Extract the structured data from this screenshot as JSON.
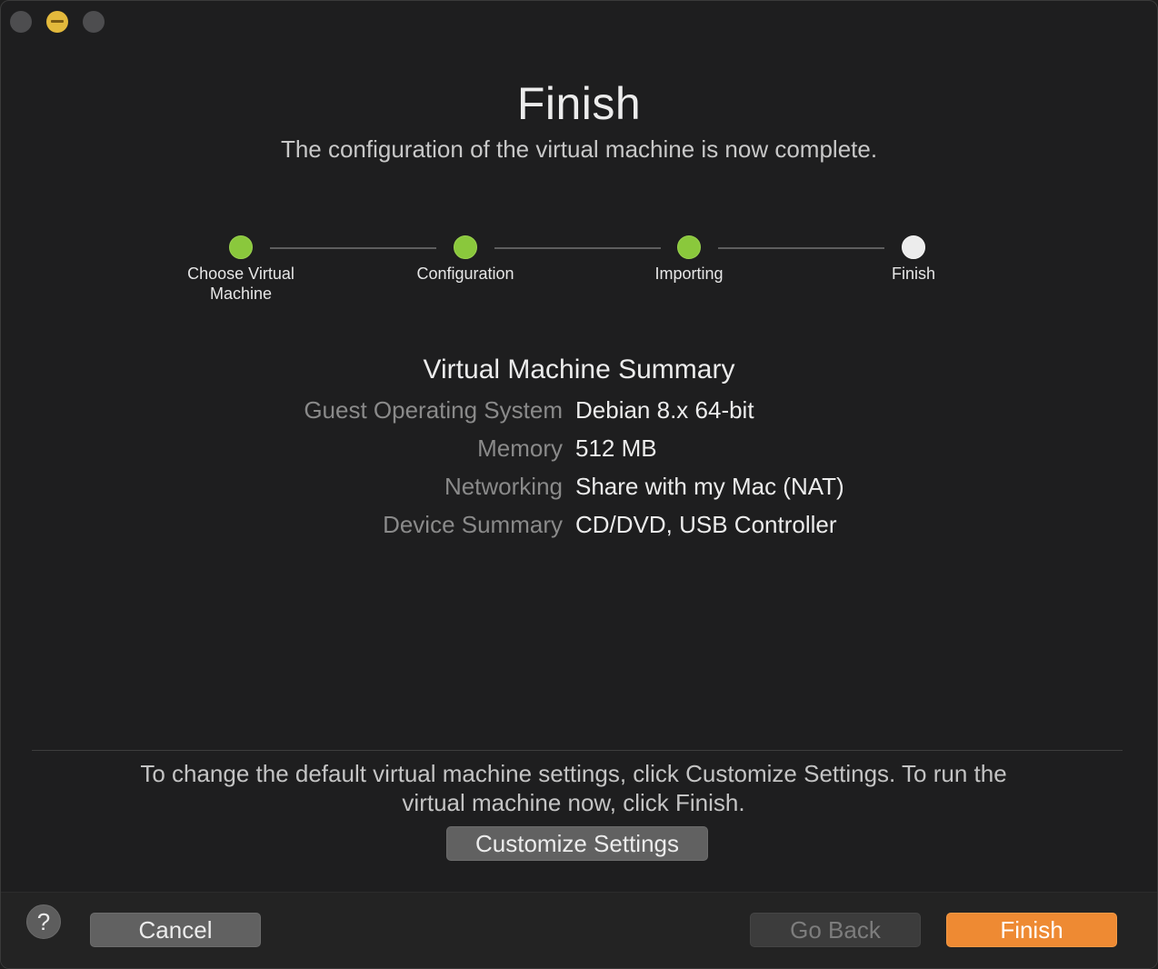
{
  "window": {
    "title_bar": {
      "buttons": [
        "close",
        "minimize",
        "zoom"
      ]
    }
  },
  "header": {
    "title": "Finish",
    "subtitle": "The configuration of the virtual machine is now complete."
  },
  "steps": [
    {
      "label_line1": "Choose Virtual",
      "label_line2": "Machine",
      "state": "complete"
    },
    {
      "label_line1": "Configuration",
      "label_line2": "",
      "state": "complete"
    },
    {
      "label_line1": "Importing",
      "label_line2": "",
      "state": "complete"
    },
    {
      "label_line1": "Finish",
      "label_line2": "",
      "state": "current"
    }
  ],
  "summary": {
    "title": "Virtual Machine Summary",
    "rows": [
      {
        "key": "Guest Operating System",
        "value": "Debian 8.x 64-bit"
      },
      {
        "key": "Memory",
        "value": "512 MB"
      },
      {
        "key": "Networking",
        "value": "Share with my Mac (NAT)"
      },
      {
        "key": "Device Summary",
        "value": "CD/DVD, USB Controller"
      }
    ]
  },
  "hint": {
    "line1": "To change the default virtual machine settings, click Customize Settings. To run the",
    "line2": "virtual machine now, click Finish."
  },
  "buttons": {
    "customize": "Customize Settings",
    "help": "?",
    "cancel": "Cancel",
    "go_back": "Go Back",
    "finish": "Finish"
  },
  "colors": {
    "step_complete": "#8ac83c",
    "step_current": "#ececec",
    "accent": "#ee8a33"
  }
}
